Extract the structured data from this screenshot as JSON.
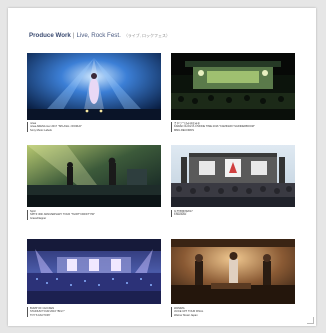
{
  "header": {
    "title": "Produce Work",
    "separator": "|",
    "subtitle": "Live, Rock Fest.",
    "subtitle_note": "（ライブ, ロックフェス）"
  },
  "works": [
    {
      "image": "concert-blue-stage-singer",
      "caption": [
        "miwa",
        "miwa ARENA tour 2017 \"SPLASH☆WORLD\"",
        "Sony Music Labels"
      ]
    },
    {
      "image": "outdoor-festival-night-stage",
      "caption": [
        "きゃりーぱみゅぱみゅ",
        "KAWAII OLOGYA C'MONE TIME 2016 \"KAMINARI THUNDERBOOM\"",
        "MMG RECORDS"
      ]
    },
    {
      "image": "band-performing-green-stage",
      "caption": [
        "Spitz",
        "SPITZ 30th ANNIVERSARY TOUR \"THIRTY30FIFTY50\"",
        "Grass/Napper"
      ]
    },
    {
      "image": "festival-stage-blue-sky",
      "caption": [
        "氣志團萬博2017",
        "KISHIDAN",
        ""
      ]
    },
    {
      "image": "arena-concert-blue-crowd",
      "caption": [
        "BUMP OF CHICKEN",
        "STADIUM TOUR 2016 \"BFLY\"",
        "TOY'S FACTORY"
      ]
    },
    {
      "image": "band-playing-warm-lights",
      "caption": [
        "WANIMA",
        "JUICE UP!! TOUR FINAL",
        "Warner Music Japan"
      ]
    }
  ]
}
